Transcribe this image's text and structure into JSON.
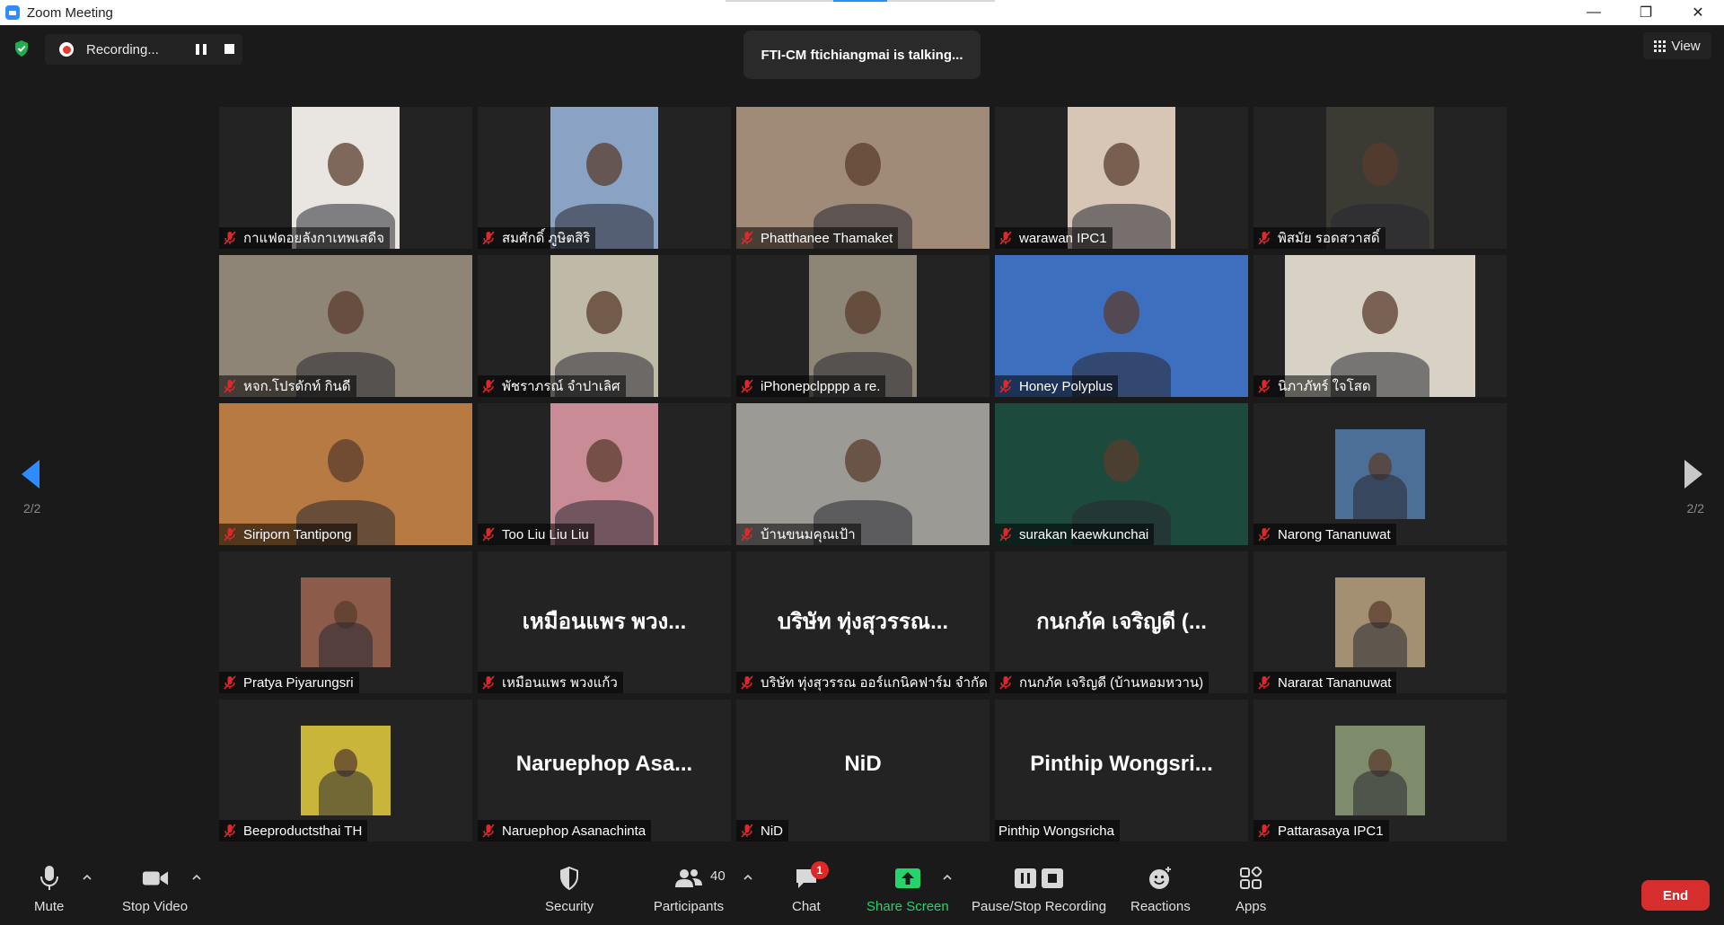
{
  "window": {
    "title": "Zoom Meeting",
    "minimize": "—",
    "restore": "❐",
    "close": "✕"
  },
  "recording": {
    "label": "Recording..."
  },
  "talking": {
    "text": "FTI-CM ftichiangmai is talking..."
  },
  "view": {
    "label": "View"
  },
  "pagination": {
    "left": "2/2",
    "right": "2/2"
  },
  "tiles": [
    {
      "name": "กาแฟดอยลังกาเทพเสดีจ",
      "muted": true,
      "video": true,
      "bg": "#e9e6e1",
      "bigname": ""
    },
    {
      "name": "สมศักดิ์ ภูษิตสิริ",
      "muted": true,
      "video": true,
      "bg": "#8aa3c4",
      "bigname": ""
    },
    {
      "name": "Phatthanee Thamaket",
      "muted": true,
      "video": true,
      "bg": "#a08a78",
      "bigname": ""
    },
    {
      "name": "warawan IPC1",
      "muted": true,
      "video": true,
      "bg": "#d7c6b6",
      "bigname": ""
    },
    {
      "name": "พิสมัย รอดสวาสดิ์",
      "muted": true,
      "video": true,
      "bg": "#3b3b34",
      "bigname": ""
    },
    {
      "name": "หจก.โปรดักท์ กินดี",
      "muted": true,
      "video": true,
      "bg": "#8f8577",
      "bigname": ""
    },
    {
      "name": "พัชราภรณ์ จำปาเลิศ",
      "muted": true,
      "video": true,
      "bg": "#bfb9a8",
      "bigname": ""
    },
    {
      "name": "iPhonepclpppp a re.",
      "muted": true,
      "video": true,
      "bg": "#8d8576",
      "bigname": ""
    },
    {
      "name": "Honey Polyplus",
      "muted": true,
      "video": true,
      "bg": "#3e6fbf",
      "bigname": ""
    },
    {
      "name": "นิภาภัทร์ ใจโสด",
      "muted": true,
      "video": true,
      "bg": "#d8d2c6",
      "bigname": ""
    },
    {
      "name": "Siriporn Tantipong",
      "muted": true,
      "video": true,
      "bg": "#b77a42",
      "bigname": ""
    },
    {
      "name": "Too Liu Liu Liu",
      "muted": true,
      "video": true,
      "bg": "#c98c97",
      "bigname": ""
    },
    {
      "name": "บ้านขนมคุณเป้า",
      "muted": true,
      "video": true,
      "bg": "#9c9a95",
      "bigname": ""
    },
    {
      "name": "surakan kaewkunchai",
      "muted": true,
      "video": true,
      "bg": "#1c4a3c",
      "bigname": ""
    },
    {
      "name": "Narong Tananuwat",
      "muted": true,
      "video": true,
      "bg": "#4b6f96",
      "bigname": ""
    },
    {
      "name": "Pratya Piyarungsri",
      "muted": true,
      "video": true,
      "bg": "#8c5b4a",
      "bigname": ""
    },
    {
      "name": "เหมือนแพร พวงแก้ว",
      "muted": true,
      "video": false,
      "bg": "#232323",
      "bigname": "เหมือนแพร พวง..."
    },
    {
      "name": "บริษัท ทุ่งสุวรรณ ออร์แกนิคฟาร์ม จำกัด",
      "muted": true,
      "video": false,
      "bg": "#232323",
      "bigname": "บริษัท ทุ่งสุวรรณ..."
    },
    {
      "name": "กนกภัค เจริญดี (บ้านหอมหวาน)",
      "muted": true,
      "video": false,
      "bg": "#232323",
      "bigname": "กนกภัค เจริญดี (..."
    },
    {
      "name": "Nararat Tananuwat",
      "muted": true,
      "video": true,
      "bg": "#a38f72",
      "bigname": ""
    },
    {
      "name": "Beeproductsthai TH",
      "muted": true,
      "video": true,
      "bg": "#c9b53a",
      "bigname": ""
    },
    {
      "name": "Naruephop Asanachinta",
      "muted": true,
      "video": false,
      "bg": "#232323",
      "bigname": "Naruephop  Asa..."
    },
    {
      "name": "NiD",
      "muted": true,
      "video": false,
      "bg": "#232323",
      "bigname": "NiD"
    },
    {
      "name": "Pinthip Wongsricha",
      "muted": false,
      "video": false,
      "bg": "#232323",
      "bigname": "Pinthip  Wongsri..."
    },
    {
      "name": "Pattarasaya IPC1",
      "muted": true,
      "video": true,
      "bg": "#7f8c6c",
      "bigname": ""
    }
  ],
  "toolbar": {
    "mute": "Mute",
    "stop_video": "Stop Video",
    "security": "Security",
    "participants": "Participants",
    "participants_count": "40",
    "chat": "Chat",
    "chat_badge": "1",
    "share_screen": "Share Screen",
    "pause_stop_recording": "Pause/Stop Recording",
    "reactions": "Reactions",
    "apps": "Apps",
    "end": "End"
  },
  "colors": {
    "accent": "#2d8cff",
    "share": "#27d46b",
    "end": "#d62d2d",
    "muted": "#e02828",
    "recording": "#e03c31"
  }
}
